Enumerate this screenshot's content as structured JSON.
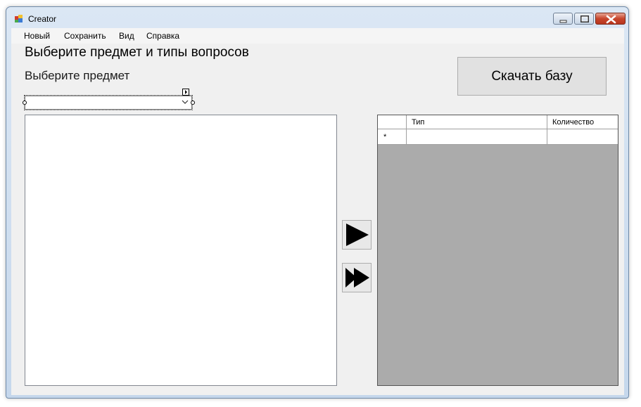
{
  "window": {
    "title": "Creator"
  },
  "menu": {
    "items": [
      "Новый",
      "Сохранить",
      "Вид",
      "Справка"
    ]
  },
  "form": {
    "heading": "Выберите предмет и типы вопросов",
    "subject_label": "Выберите предмет",
    "subject_combo_value": "",
    "download_button": "Скачать базу",
    "add_button_icon": "play-arrow-icon",
    "add_all_button_icon": "fast-forward-icon"
  },
  "grid": {
    "columns": [
      "Тип",
      "Количество"
    ],
    "new_row_marker": "*"
  },
  "colors": {
    "client_background": "#f0f0f0",
    "grid_background": "#ababab",
    "close_button": "#c7452c"
  }
}
